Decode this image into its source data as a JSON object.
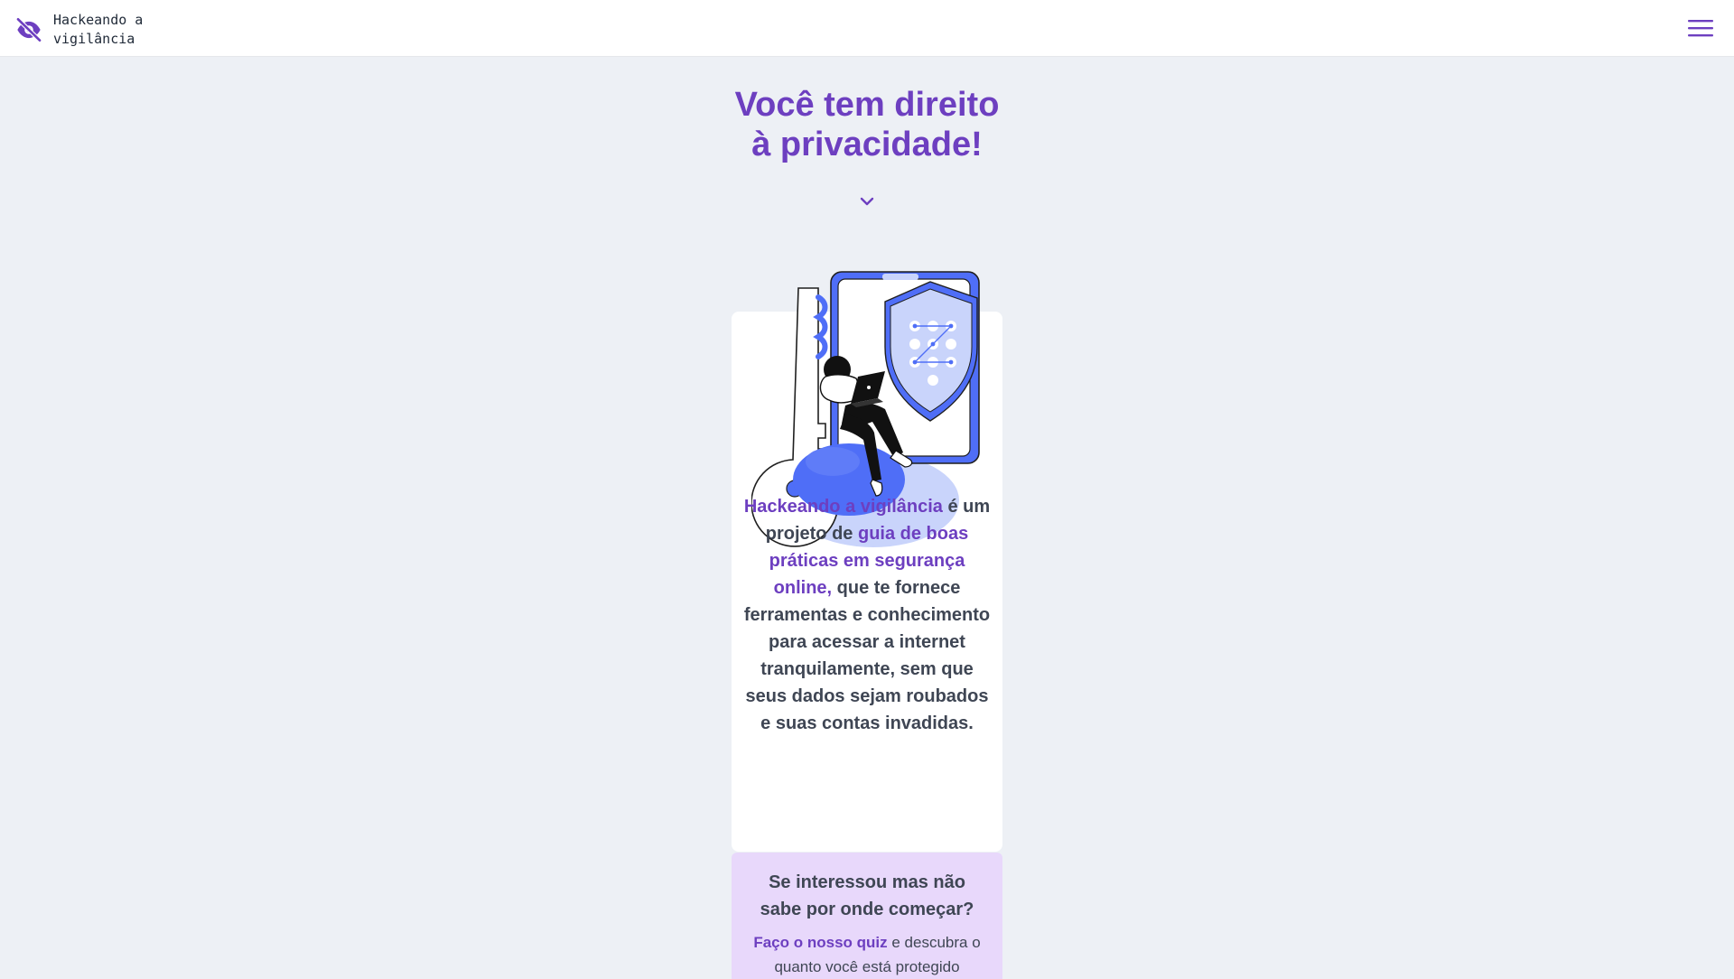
{
  "site": {
    "brand_name": "Hackeando a vigilância",
    "logo_icon": "eye-slash-icon",
    "menu_icon": "hamburger-menu-icon"
  },
  "hero": {
    "title_line1": "Você tem direito",
    "title_line2": "à privacidade!",
    "scroll_icon": "chevron-down-icon"
  },
  "intro": {
    "highlight_project": "Hackeando a vigilância",
    "text_1": " é um projeto de ",
    "highlight_guide": "guia de boas práticas em segurança online,",
    "text_2": " que te fornece ferramentas e conhecimento para acessar a internet tranquilamente, sem que seus dados sejam roubados e suas contas invadidas."
  },
  "quiz": {
    "title": "Se interessou mas não sabe por onde começar?",
    "link_label": "Faço o nosso quiz",
    "text": " e descubra o quanto você está protegido"
  },
  "colors": {
    "accent": "#6d3fc0",
    "background": "#edf0f5",
    "text": "#3f4654",
    "quiz_bg": "#e8d8fb",
    "illustration_blue": "#4f6ef7"
  }
}
